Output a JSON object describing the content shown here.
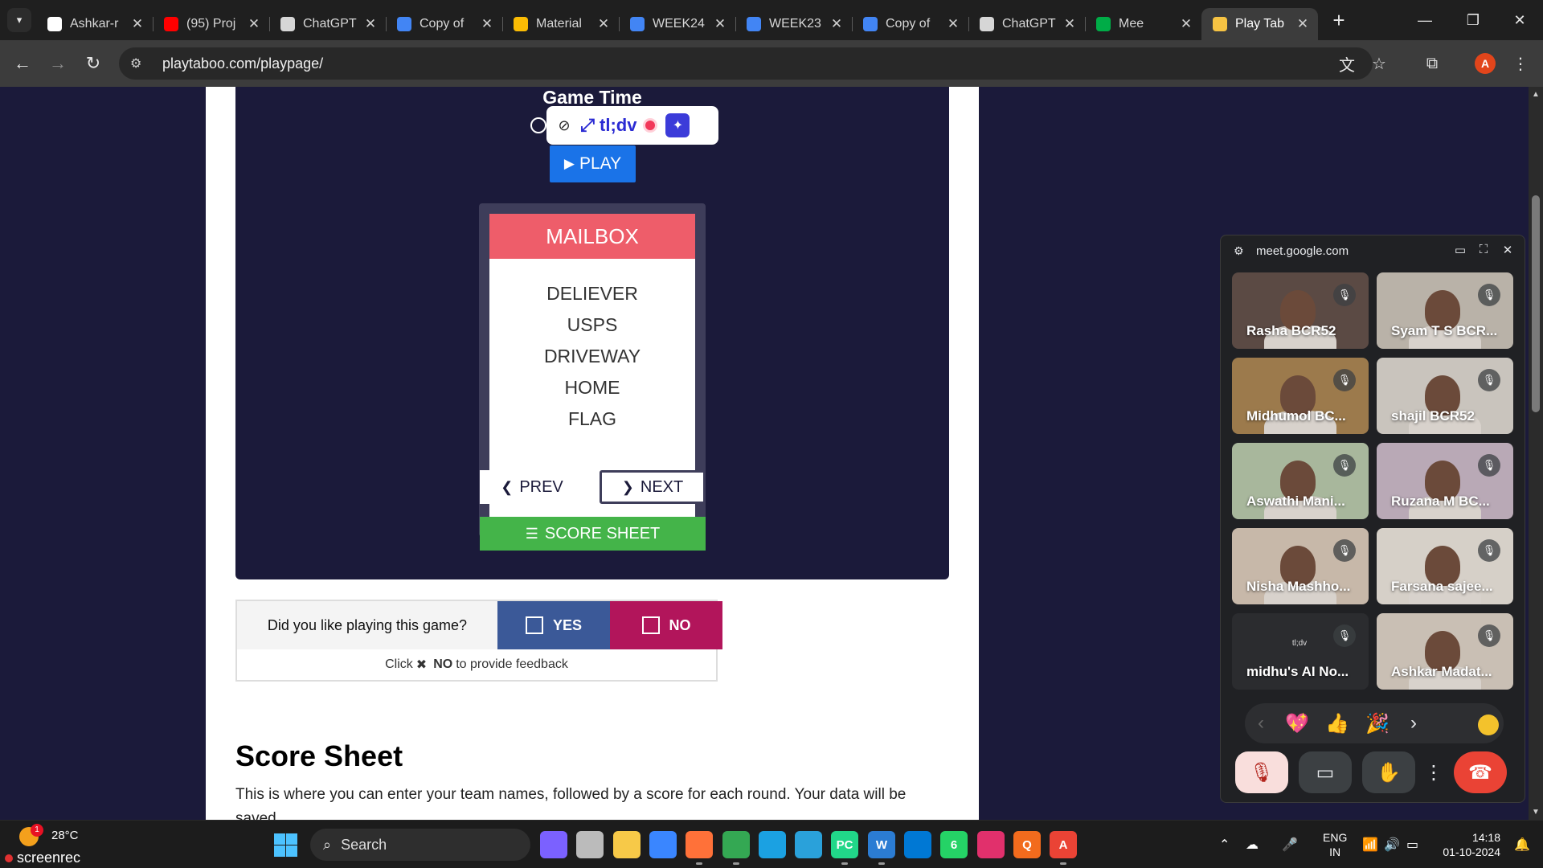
{
  "browser": {
    "tabs": [
      {
        "title": "Ashkar-r",
        "icon": "github-icon",
        "color": "#ffffff"
      },
      {
        "title": "(95) Proj",
        "icon": "youtube-icon",
        "color": "#ff0000"
      },
      {
        "title": "ChatGPT",
        "icon": "chatgpt-icon",
        "color": "#d6d6d6"
      },
      {
        "title": "Copy of",
        "icon": "docs-icon",
        "color": "#4285f4"
      },
      {
        "title": "Material",
        "icon": "drive-icon",
        "color": "#fbbc04"
      },
      {
        "title": "WEEK24",
        "icon": "docs-icon",
        "color": "#4285f4"
      },
      {
        "title": "WEEK23",
        "icon": "docs-icon",
        "color": "#4285f4"
      },
      {
        "title": "Copy of",
        "icon": "docs-icon",
        "color": "#4285f4"
      },
      {
        "title": "ChatGPT",
        "icon": "chatgpt-icon",
        "color": "#d6d6d6"
      },
      {
        "title": "Mee",
        "icon": "meet-icon",
        "color": "#00ac47"
      },
      {
        "title": "Play Tab",
        "icon": "playtaboo-icon",
        "color": "#f6c343"
      }
    ],
    "url": "playtaboo.com/playpage/",
    "profile_initial": "A"
  },
  "game": {
    "title": "Game Time",
    "tldv_label": "tl;dv",
    "play_label": "PLAY",
    "card": {
      "word": "MAILBOX",
      "taboo_words": [
        "DELIEVER",
        "USPS",
        "DRIVEWAY",
        "HOME",
        "FLAG"
      ]
    },
    "prev_label": "PREV",
    "next_label": "NEXT",
    "score_sheet_label": "SCORE SHEET"
  },
  "feedback": {
    "question": "Did you like playing this game?",
    "yes": "YES",
    "no": "NO",
    "hint_before": "Click",
    "hint_icon": "✖",
    "hint_bold": "NO",
    "hint_after": "to provide feedback"
  },
  "score_sheet": {
    "title": "Score Sheet",
    "description": "This is where you can enter your team names, followed by a score for each round. Your data will be saved."
  },
  "meet": {
    "domain": "meet.google.com",
    "participants": [
      {
        "name": "Rasha BCR52",
        "bg": "#5b4a44"
      },
      {
        "name": "Syam T S BCR...",
        "bg": "#b9b2a8"
      },
      {
        "name": "Midhumol BC...",
        "bg": "#9c7a4c"
      },
      {
        "name": "shajil BCR52",
        "bg": "#c9c4bd"
      },
      {
        "name": "Aswathi Mani...",
        "bg": "#a8b79c"
      },
      {
        "name": "Ruzana M BC...",
        "bg": "#b9a9b6"
      },
      {
        "name": "Nisha Mashho...",
        "bg": "#c7b8a9"
      },
      {
        "name": "Farsana sajee...",
        "bg": "#d6d0c8"
      },
      {
        "name": "midhu's AI No...",
        "bg": "#2b2c2f",
        "logo": "tl;dv"
      },
      {
        "name": "Ashkar Madat...",
        "bg": "#c9bfb4"
      }
    ],
    "reactions": [
      "💖",
      "👍",
      "🎉"
    ]
  },
  "taskbar": {
    "weather_temp": "28°C",
    "weather_badge": "1",
    "screenrec_label": "screenrec",
    "search_placeholder": "Search",
    "apps": [
      {
        "label": "",
        "icon": "copilot-icon",
        "color": "#7b61ff"
      },
      {
        "label": "",
        "icon": "task-view-icon",
        "color": "#bbbbbb"
      },
      {
        "label": "",
        "icon": "file-explorer-icon",
        "color": "#f7c948"
      },
      {
        "label": "",
        "icon": "store-icon",
        "color": "#3a86ff"
      },
      {
        "label": "",
        "icon": "firefox-icon",
        "color": "#ff7139"
      },
      {
        "label": "",
        "icon": "chrome-icon",
        "color": "#34a853"
      },
      {
        "label": "",
        "icon": "edge-icon",
        "color": "#1ba1e2"
      },
      {
        "label": "",
        "icon": "telegram-icon",
        "color": "#2aa1da"
      },
      {
        "label": "PC",
        "icon": "pycharm-icon",
        "color": "#21d789"
      },
      {
        "label": "W",
        "icon": "word-icon",
        "color": "#2b7cd3"
      },
      {
        "label": "",
        "icon": "vscode-icon",
        "color": "#0078d4"
      },
      {
        "label": "6",
        "icon": "whatsapp-icon",
        "color": "#25d366"
      },
      {
        "label": "",
        "icon": "instagram-icon",
        "color": "#e1306c"
      },
      {
        "label": "Q",
        "icon": "q-app-icon",
        "color": "#f26b1d"
      },
      {
        "label": "A",
        "icon": "chrome-profile-icon",
        "color": "#ea4335"
      }
    ],
    "language": "ENG",
    "region": "IN",
    "time": "14:18",
    "date": "01-10-2024"
  }
}
